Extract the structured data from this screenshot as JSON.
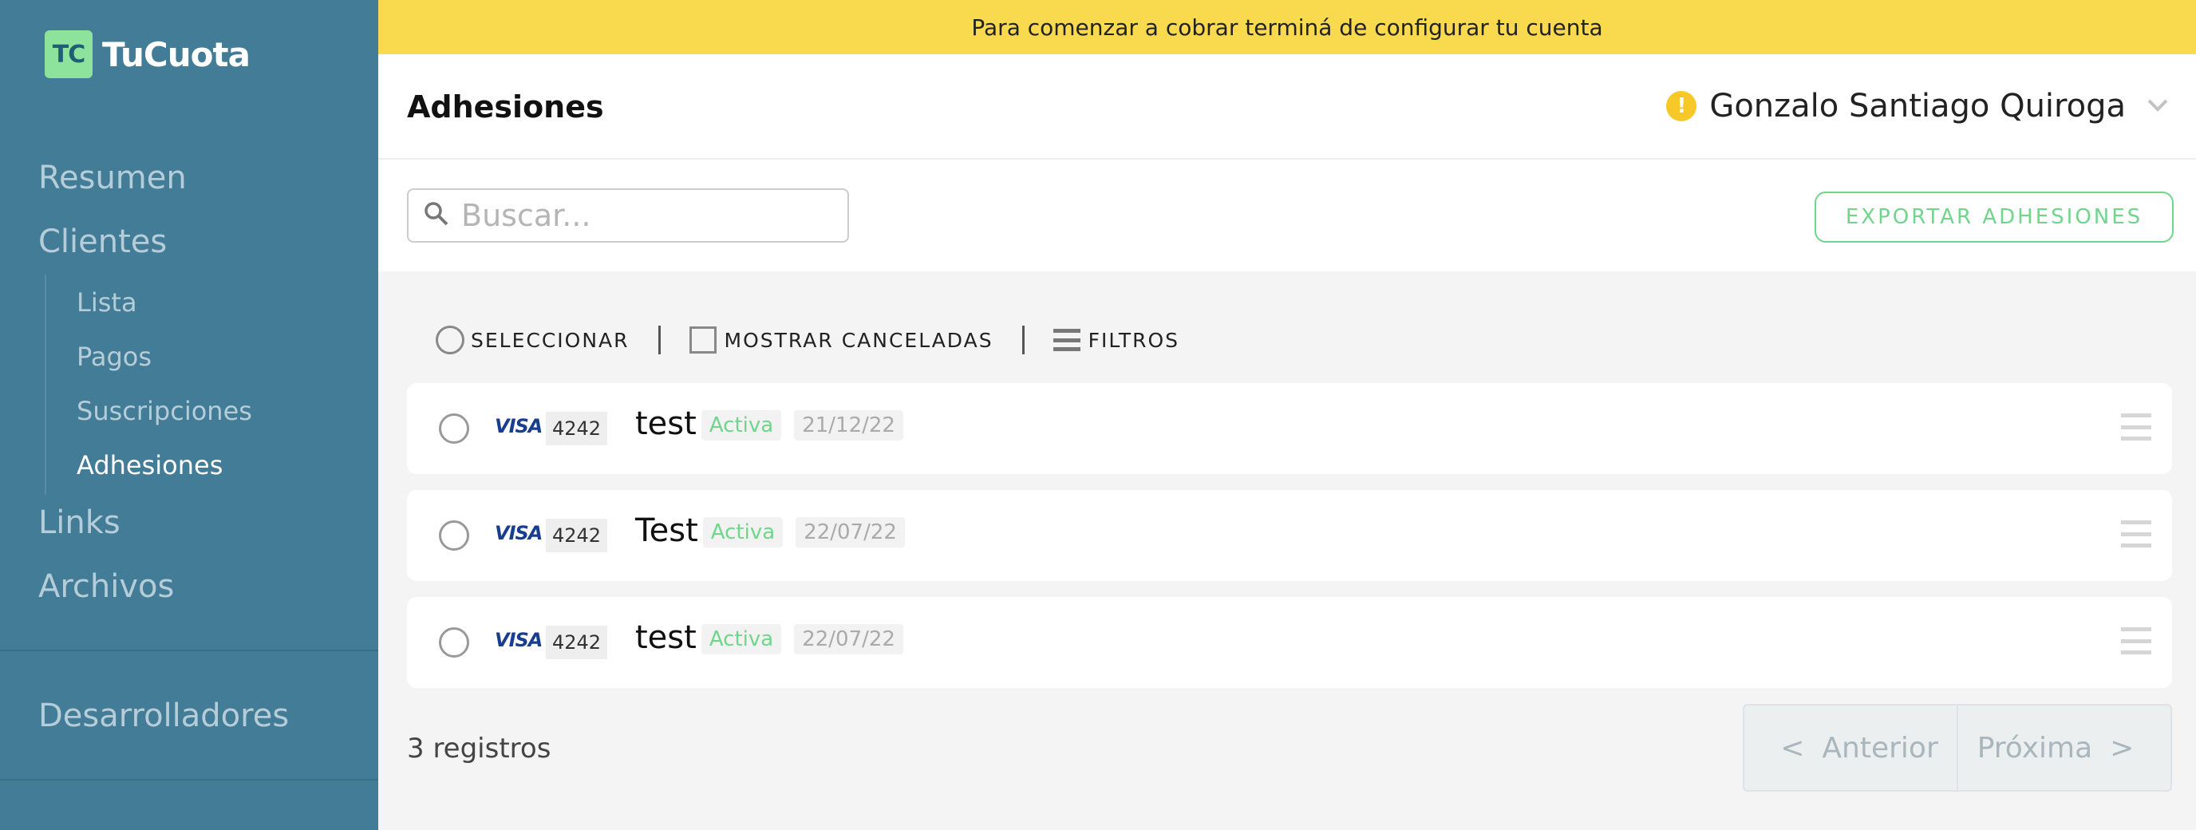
{
  "app": {
    "logo_badge": "TC",
    "name": "TuCuota"
  },
  "sidebar": {
    "items": [
      {
        "label": "Resumen"
      },
      {
        "label": "Clientes"
      },
      {
        "label": "Links"
      },
      {
        "label": "Archivos"
      },
      {
        "label": "Desarrolladores"
      }
    ],
    "sub_items": [
      {
        "label": "Lista"
      },
      {
        "label": "Pagos"
      },
      {
        "label": "Suscripciones"
      },
      {
        "label": "Adhesiones",
        "active": true
      }
    ]
  },
  "banner": {
    "text": "Para comenzar a cobrar terminá de configurar tu cuenta"
  },
  "header": {
    "title": "Adhesiones",
    "warning_icon": "exclamation-icon",
    "warning_glyph": "!",
    "user_name": "Gonzalo Santiago Quiroga",
    "dropdown_glyph": "⌄"
  },
  "search": {
    "placeholder": "Buscar..."
  },
  "export": {
    "label": "EXPORTAR ADHESIONES"
  },
  "filters": {
    "select_label": "SELECCIONAR",
    "show_cancelled_label": "MOSTRAR CANCELADAS",
    "filters_label": "FILTROS"
  },
  "rows": [
    {
      "brand": "VISA",
      "last4": "4242",
      "name": "test",
      "status": "Activa",
      "date": "21/12/22"
    },
    {
      "brand": "VISA",
      "last4": "4242",
      "name": "Test",
      "status": "Activa",
      "date": "22/07/22"
    },
    {
      "brand": "VISA",
      "last4": "4242",
      "name": "test",
      "status": "Activa",
      "date": "22/07/22"
    }
  ],
  "footer": {
    "count": "3 registros",
    "prev_arrow": "<",
    "prev_label": "Anterior",
    "next_label": "Próxima",
    "next_arrow": ">"
  },
  "colors": {
    "sidebar": "#437c97",
    "banner": "#f9da4f",
    "accent_green": "#6fd68a",
    "logo_green": "#8de39c",
    "warning": "#f6c928"
  }
}
